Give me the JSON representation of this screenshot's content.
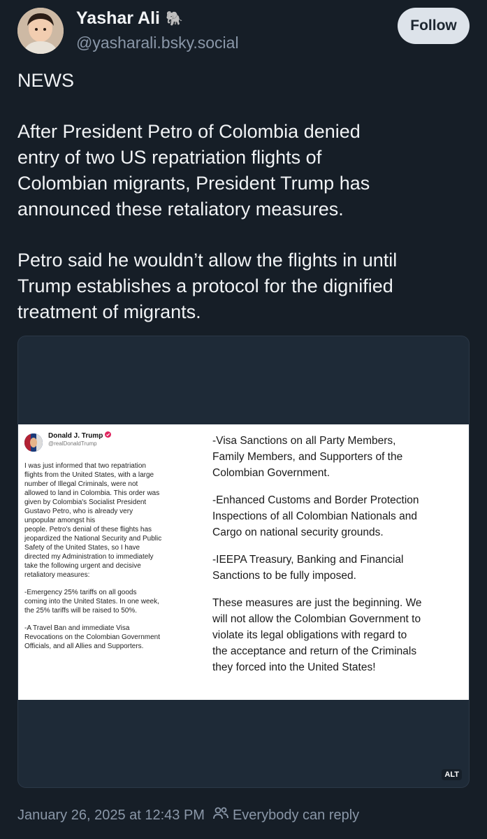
{
  "author": {
    "display_name": "Yashar Ali",
    "name_emoji": "🐘",
    "handle": "@yasharali.bsky.social",
    "avatar_icon": "user-avatar"
  },
  "follow_label": "Follow",
  "post": {
    "paragraphs": [
      [
        "NEWS"
      ],
      [
        "After President Petro of Colombia denied",
        "entry of two US repatriation flights of",
        "Colombian migrants, President Trump has",
        "announced these retaliatory measures."
      ],
      [
        "Petro said he wouldn’t allow the flights in until",
        "Trump establishes a protocol for the dignified",
        "treatment of migrants."
      ]
    ]
  },
  "embed": {
    "alt_label": "ALT",
    "screenshot": {
      "author_name": "Donald J. Trump",
      "author_handle": "@realDonaldTrump",
      "left_paragraphs": [
        [
          "I was just informed that two repatriation",
          "flights from the United States, with a large",
          "number of Illegal Criminals, were not",
          "allowed to land in Colombia. This order was",
          "given by Colombia's Socialist President",
          "Gustavo Petro, who is already very",
          "unpopular amongst his",
          "people. Petro's denial of these flights has",
          "jeopardized the National Security and Public",
          "Safety of the United States, so I have",
          "directed my Administration to immediately",
          "take the following urgent and decisive",
          "retaliatory measures:"
        ],
        [
          "-Emergency 25% tariffs on all goods",
          "coming into the United States. In one week,",
          "the 25% tariffs will be raised to 50%."
        ],
        [
          "-A Travel Ban and immediate Visa",
          "Revocations on the Colombian Government",
          "Officials, and all Allies and Supporters."
        ]
      ],
      "right_paragraphs": [
        [
          "-Visa Sanctions on all Party Members,",
          "Family Members, and Supporters of the",
          "Colombian Government."
        ],
        [
          "-Enhanced Customs and Border Protection",
          "Inspections of all Colombian Nationals and",
          "Cargo on national security grounds."
        ],
        [
          "-IEEPA Treasury, Banking and Financial",
          "Sanctions to be fully imposed."
        ],
        [
          "These measures are just the beginning. We",
          "will not allow the Colombian Government to",
          "violate its legal obligations with regard to",
          "the acceptance and return of the Criminals",
          "they forced into the United States!"
        ]
      ]
    }
  },
  "footer": {
    "timestamp": "January 26, 2025 at 12:43 PM",
    "reply_setting": "Everybody can reply",
    "reply_icon": "people-icon"
  },
  "colors": {
    "background": "#161e27",
    "muted_text": "#8a97a8",
    "follow_bg": "#dde3ea"
  }
}
